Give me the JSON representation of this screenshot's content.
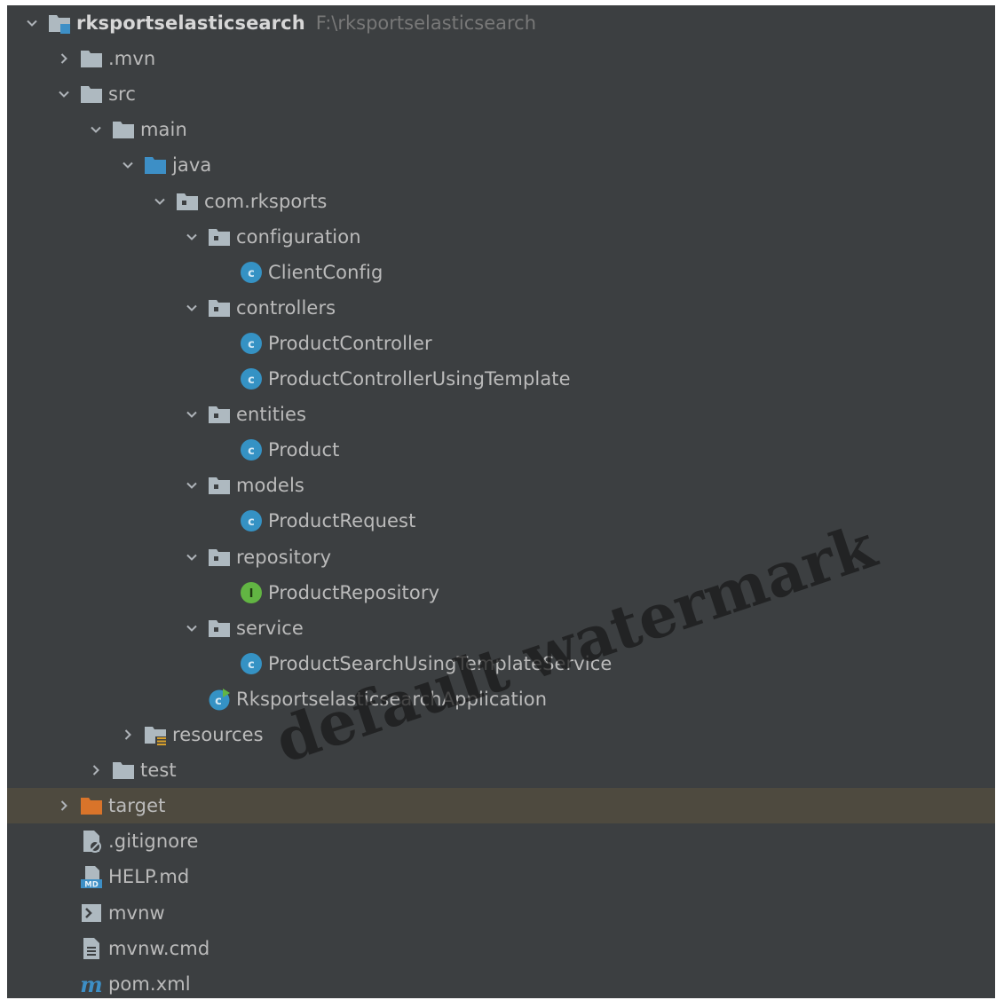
{
  "project_tree": {
    "root": {
      "label": "rksportselasticsearch",
      "path": "F:\\rksportselasticsearch"
    },
    "nodes": [
      {
        "label": ".mvn",
        "depth": 1,
        "expanded": false,
        "icon": "folder-icon"
      },
      {
        "label": "src",
        "depth": 1,
        "expanded": true,
        "icon": "folder-icon"
      },
      {
        "label": "main",
        "depth": 2,
        "expanded": true,
        "icon": "folder-icon"
      },
      {
        "label": "java",
        "depth": 3,
        "expanded": true,
        "icon": "source-folder-icon"
      },
      {
        "label": "com.rksports",
        "depth": 4,
        "expanded": true,
        "icon": "package-icon"
      },
      {
        "label": "configuration",
        "depth": 5,
        "expanded": true,
        "icon": "package-icon"
      },
      {
        "label": "ClientConfig",
        "depth": 6,
        "icon": "class-icon"
      },
      {
        "label": "controllers",
        "depth": 5,
        "expanded": true,
        "icon": "package-icon"
      },
      {
        "label": "ProductController",
        "depth": 6,
        "icon": "class-icon"
      },
      {
        "label": "ProductControllerUsingTemplate",
        "depth": 6,
        "icon": "class-icon"
      },
      {
        "label": "entities",
        "depth": 5,
        "expanded": true,
        "icon": "package-icon"
      },
      {
        "label": "Product",
        "depth": 6,
        "icon": "class-icon"
      },
      {
        "label": "models",
        "depth": 5,
        "expanded": true,
        "icon": "package-icon"
      },
      {
        "label": "ProductRequest",
        "depth": 6,
        "icon": "class-icon"
      },
      {
        "label": "repository",
        "depth": 5,
        "expanded": true,
        "icon": "package-icon"
      },
      {
        "label": "ProductRepository",
        "depth": 6,
        "icon": "interface-icon"
      },
      {
        "label": "service",
        "depth": 5,
        "expanded": true,
        "icon": "package-icon"
      },
      {
        "label": "ProductSearchUsingTemplateService",
        "depth": 6,
        "icon": "class-icon"
      },
      {
        "label": "RksportselasticsearchApplication",
        "depth": 5,
        "icon": "spring-app-class-icon"
      },
      {
        "label": "resources",
        "depth": 3,
        "expanded": false,
        "icon": "resources-folder-icon"
      },
      {
        "label": "test",
        "depth": 2,
        "expanded": false,
        "icon": "folder-icon"
      },
      {
        "label": "target",
        "depth": 1,
        "expanded": false,
        "icon": "excluded-folder-icon",
        "selected": true
      },
      {
        "label": ".gitignore",
        "depth": 1,
        "icon": "ignore-file-icon"
      },
      {
        "label": "HELP.md",
        "depth": 1,
        "icon": "markdown-file-icon"
      },
      {
        "label": "mvnw",
        "depth": 1,
        "icon": "shell-script-icon"
      },
      {
        "label": "mvnw.cmd",
        "depth": 1,
        "icon": "text-file-icon"
      },
      {
        "label": "pom.xml",
        "depth": 1,
        "icon": "maven-icon"
      }
    ]
  },
  "colors": {
    "panel_bg": "#3c3f41",
    "selection_bg": "#4e4a3f",
    "text": "#bbbbbb",
    "folder": "#aeb9c0",
    "source_folder": "#3d8fc6",
    "excluded_folder": "#d9742a",
    "class": "#3592c4",
    "interface": "#62b543"
  },
  "watermark": "default watermark"
}
